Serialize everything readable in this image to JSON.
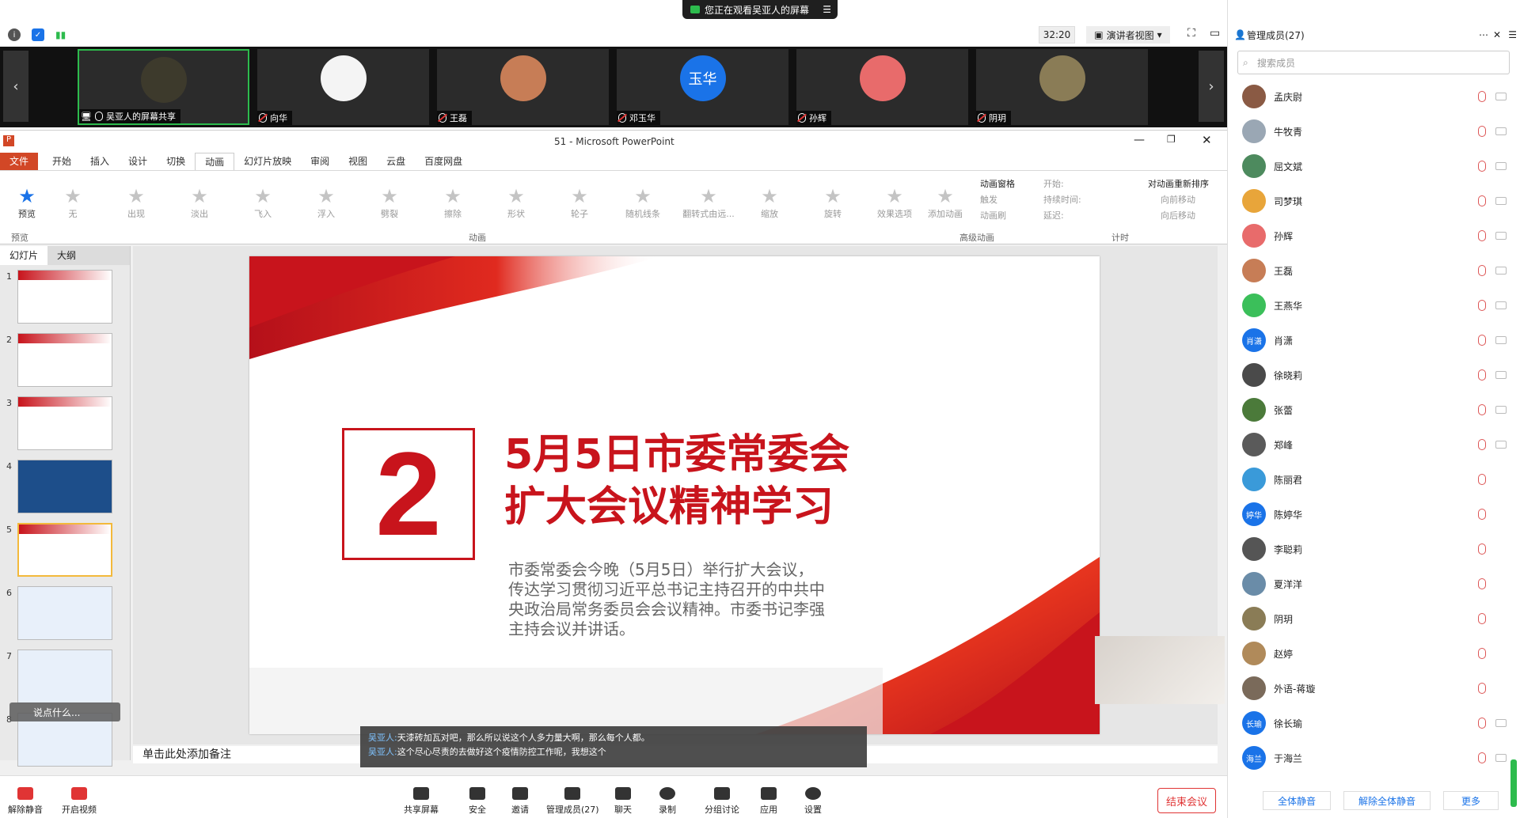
{
  "banner": {
    "text": "您正在观看吴亚人的屏幕"
  },
  "toolbar_top": {
    "timer": "32:20",
    "view_mode": "演讲者视图"
  },
  "video_strip": [
    {
      "name": "吴亚人的屏幕共享",
      "avatar_text": "",
      "avatar_color": "#3d3a2c"
    },
    {
      "name": "向华",
      "avatar_text": "",
      "avatar_color": "#f4f4f4"
    },
    {
      "name": "王磊",
      "avatar_text": "",
      "avatar_color": "#c77d56"
    },
    {
      "name": "邓玉华",
      "avatar_text": "玉华",
      "avatar_color": "#1a73e8"
    },
    {
      "name": "孙辉",
      "avatar_text": "",
      "avatar_color": "#e86b6b"
    },
    {
      "name": "阴玥",
      "avatar_text": "",
      "avatar_color": "#8a7c56"
    }
  ],
  "ppt": {
    "window_title": "51 - Microsoft PowerPoint",
    "tabs": [
      "文件",
      "开始",
      "插入",
      "设计",
      "切换",
      "动画",
      "幻灯片放映",
      "审阅",
      "视图",
      "云盘",
      "百度网盘"
    ],
    "selected_tab": "动画",
    "preview_label": "预览",
    "preview_group": "预览",
    "animations": [
      "无",
      "出现",
      "淡出",
      "飞入",
      "浮入",
      "劈裂",
      "擦除",
      "形状",
      "轮子",
      "随机线条",
      "翻转式由远...",
      "缩放",
      "旋转"
    ],
    "effect_options": "效果选项",
    "anim_group": "动画",
    "add_animation": "添加动画",
    "adv_items": [
      "动画窗格",
      "触发",
      "动画刷"
    ],
    "adv_group": "高级动画",
    "timing": [
      "开始:",
      "持续时间:",
      "延迟:"
    ],
    "timing_group": "计时",
    "reorder_title": "对动画重新排序",
    "reorder": [
      "向前移动",
      "向后移动"
    ],
    "panel_tabs": [
      "幻灯片",
      "大纲"
    ],
    "notes": "单击此处添加备注"
  },
  "slide": {
    "number": "2",
    "title_line1": "5月5日市委常委会",
    "title_line2": "扩大会议精神学习",
    "body": "市委常委会今晚（5月5日）举行扩大会议，传达学习贯彻习近平总书记主持召开的中共中央政治局常务委员会会议精神。市委书记李强主持会议并讲话。"
  },
  "captions": [
    {
      "speaker": "吴亚人:",
      "text": "天漆砖加瓦对吧，那么所以说这个人多力量大啊，那么每个人都。"
    },
    {
      "speaker": "吴亚人:",
      "text": "这个尽心尽责的去做好这个疫情防控工作呢，我想这个"
    }
  ],
  "chat_prompt": "说点什么...",
  "bottom_toolbar": [
    "解除静音",
    "开启视频",
    "共享屏幕",
    "安全",
    "邀请",
    "管理成员(27)",
    "聊天",
    "录制",
    "分组讨论",
    "应用",
    "设置"
  ],
  "end_meeting": "结束会议",
  "members_panel": {
    "title": "管理成员(27)",
    "search_placeholder": "搜索成员",
    "members": [
      {
        "name": "孟庆尉",
        "avatar": "",
        "color": "#8a5a44"
      },
      {
        "name": "牛牧青",
        "avatar": "",
        "color": "#9aa7b4"
      },
      {
        "name": "屈文斌",
        "avatar": "",
        "color": "#4d8a5e"
      },
      {
        "name": "司梦琪",
        "avatar": "",
        "color": "#e8a53a"
      },
      {
        "name": "孙辉",
        "avatar": "",
        "color": "#e86b6b"
      },
      {
        "name": "王磊",
        "avatar": "",
        "color": "#c77d56"
      },
      {
        "name": "王燕华",
        "avatar": "",
        "color": "#3bbf5a"
      },
      {
        "name": "肖潇",
        "avatar": "肖潇",
        "color": "#1a73e8"
      },
      {
        "name": "徐晓莉",
        "avatar": "",
        "color": "#4a4a4a"
      },
      {
        "name": "张蕾",
        "avatar": "",
        "color": "#4b7a3a"
      },
      {
        "name": "郑峰",
        "avatar": "",
        "color": "#5a5a5a"
      },
      {
        "name": "陈丽君",
        "avatar": "",
        "color": "#3a9ad9"
      },
      {
        "name": "陈婷华",
        "avatar": "婷华",
        "color": "#1a73e8"
      },
      {
        "name": "李聪莉",
        "avatar": "",
        "color": "#555555"
      },
      {
        "name": "夏洋洋",
        "avatar": "",
        "color": "#6a8ca8"
      },
      {
        "name": "阴玥",
        "avatar": "",
        "color": "#8a7c56"
      },
      {
        "name": "赵婷",
        "avatar": "",
        "color": "#b08a5a"
      },
      {
        "name": "外语-蒋璇",
        "avatar": "",
        "color": "#7a6a5a"
      },
      {
        "name": "徐长瑜",
        "avatar": "长瑜",
        "color": "#1a73e8"
      },
      {
        "name": "于海兰",
        "avatar": "海兰",
        "color": "#1a73e8"
      }
    ],
    "mute_all": "全体静音",
    "unmute_all": "解除全体静音",
    "more": "更多"
  }
}
